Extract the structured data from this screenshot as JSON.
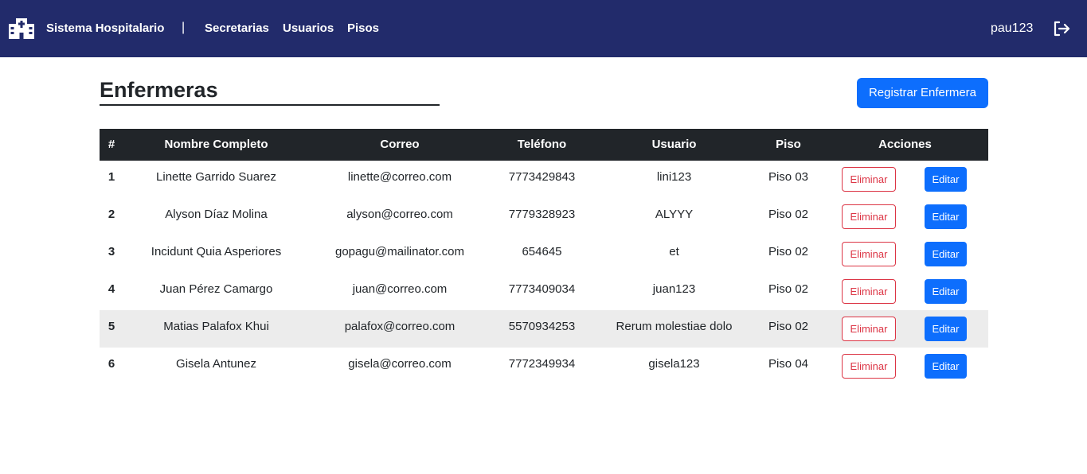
{
  "navbar": {
    "brand": "Sistema Hospitalario",
    "separator": "|",
    "links": [
      "Secretarias",
      "Usuarios",
      "Pisos"
    ],
    "user": "pau123",
    "brand_icon": "hospital-icon",
    "logout_icon": "logout-icon"
  },
  "page": {
    "title": "Enfermeras",
    "register_label": "Registrar Enfermera"
  },
  "table": {
    "headers": [
      "#",
      "Nombre Completo",
      "Correo",
      "Teléfono",
      "Usuario",
      "Piso",
      "Acciones"
    ],
    "delete_label": "Eliminar",
    "edit_label": "Editar",
    "rows": [
      {
        "n": "1",
        "name": "Linette Garrido Suarez",
        "email": "linette@correo.com",
        "phone": "7773429843",
        "user": "lini123",
        "floor": "Piso 03"
      },
      {
        "n": "2",
        "name": "Alyson Díaz Molina",
        "email": "alyson@correo.com",
        "phone": "7779328923",
        "user": "ALYYY",
        "floor": "Piso 02"
      },
      {
        "n": "3",
        "name": "Incidunt Quia Asperiores",
        "email": "gopagu@mailinator.com",
        "phone": "654645",
        "user": "et",
        "floor": "Piso 02"
      },
      {
        "n": "4",
        "name": "Juan Pérez Camargo",
        "email": "juan@correo.com",
        "phone": "7773409034",
        "user": "juan123",
        "floor": "Piso 02"
      },
      {
        "n": "5",
        "name": "Matias Palafox Khui",
        "email": "palafox@correo.com",
        "phone": "5570934253",
        "user": "Rerum molestiae dolo",
        "floor": "Piso 02"
      },
      {
        "n": "6",
        "name": "Gisela Antunez",
        "email": "gisela@correo.com",
        "phone": "7772349934",
        "user": "gisela123",
        "floor": "Piso 04"
      }
    ]
  },
  "colors": {
    "navbar": "#222b6b",
    "primary": "#0d6efd",
    "danger": "#dc3545",
    "table_header": "#212529",
    "row_highlight": "#ececec"
  }
}
